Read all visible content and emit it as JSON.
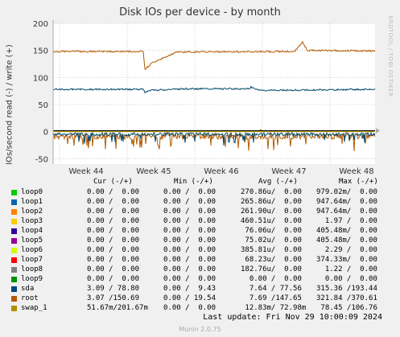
{
  "chart_data": {
    "type": "line",
    "title": "Disk IOs per device - by month",
    "ylabel": "IOs/second read (-) / write (+)",
    "ylim": [
      -60,
      200
    ],
    "yticks": [
      -50,
      0,
      50,
      100,
      150,
      200
    ],
    "x_ticks": [
      "Week 44",
      "Week 45",
      "Week 46",
      "Week 47",
      "Week 48"
    ],
    "grid": true,
    "series": [
      {
        "name": "root",
        "color": "#b35a00",
        "write_profile": [
          [
            0,
            148
          ],
          [
            0.28,
            148
          ],
          [
            0.285,
            115
          ],
          [
            0.31,
            128
          ],
          [
            0.36,
            140
          ],
          [
            0.38,
            147
          ],
          [
            0.75,
            148
          ],
          [
            0.775,
            165
          ],
          [
            0.79,
            150
          ],
          [
            1,
            149
          ]
        ],
        "read_profile": [
          [
            0,
            -8
          ],
          [
            1,
            -8
          ]
        ]
      },
      {
        "name": "sda",
        "color": "#00486b",
        "write_profile": [
          [
            0,
            78
          ],
          [
            0.28,
            78
          ],
          [
            0.285,
            72
          ],
          [
            0.3,
            76
          ],
          [
            0.4,
            79
          ],
          [
            0.61,
            79
          ],
          [
            0.615,
            82
          ],
          [
            0.64,
            76
          ],
          [
            1,
            78
          ]
        ],
        "read_profile": [
          [
            0,
            -3
          ],
          [
            1,
            -3
          ]
        ]
      },
      {
        "name": "swap_1",
        "color": "#b39500",
        "write_profile": [
          [
            0,
            0
          ],
          [
            0.64,
            0
          ],
          [
            0.645,
            4
          ],
          [
            0.65,
            0
          ],
          [
            1,
            0
          ]
        ],
        "read_profile": [
          [
            0,
            0
          ],
          [
            1,
            0
          ]
        ]
      }
    ]
  },
  "side_label": "IOs/second read (-) / write (+)",
  "watermark": "RRDTOOL / TOBI OETIKER",
  "legend": {
    "headers": {
      "cur": "Cur (-/+)",
      "min": "Min (-/+)",
      "avg": "Avg (-/+)",
      "max": "Max (-/+)"
    },
    "rows": [
      {
        "name": "loop0",
        "color": "#00cc00",
        "cur": "0.00 /  0.00",
        "min": "0.00 /  0.00",
        "avg": "270.86u/  0.00",
        "max": "979.02m/  0.00"
      },
      {
        "name": "loop1",
        "color": "#0066b3",
        "cur": "0.00 /  0.00",
        "min": "0.00 /  0.00",
        "avg": "265.86u/  0.00",
        "max": "947.64m/  0.00"
      },
      {
        "name": "loop2",
        "color": "#ff8000",
        "cur": "0.00 /  0.00",
        "min": "0.00 /  0.00",
        "avg": "261.90u/  0.00",
        "max": "947.64m/  0.00"
      },
      {
        "name": "loop3",
        "color": "#ffcc00",
        "cur": "0.00 /  0.00",
        "min": "0.00 /  0.00",
        "avg": "460.51u/  0.00",
        "max": "  1.97 /  0.00"
      },
      {
        "name": "loop4",
        "color": "#330099",
        "cur": "0.00 /  0.00",
        "min": "0.00 /  0.00",
        "avg": " 76.06u/  0.00",
        "max": "405.48m/  0.00"
      },
      {
        "name": "loop5",
        "color": "#990099",
        "cur": "0.00 /  0.00",
        "min": "0.00 /  0.00",
        "avg": " 75.02u/  0.00",
        "max": "405.48m/  0.00"
      },
      {
        "name": "loop6",
        "color": "#ccff00",
        "cur": "0.00 /  0.00",
        "min": "0.00 /  0.00",
        "avg": "385.81u/  0.00",
        "max": "  2.29 /  0.00"
      },
      {
        "name": "loop7",
        "color": "#ff0000",
        "cur": "0.00 /  0.00",
        "min": "0.00 /  0.00",
        "avg": " 68.23u/  0.00",
        "max": "374.33m/  0.00"
      },
      {
        "name": "loop8",
        "color": "#808080",
        "cur": "0.00 /  0.00",
        "min": "0.00 /  0.00",
        "avg": "182.76u/  0.00",
        "max": "  1.22 /  0.00"
      },
      {
        "name": "loop9",
        "color": "#008f00",
        "cur": "0.00 /  0.00",
        "min": "0.00 /  0.00",
        "avg": "  0.00 /  0.00",
        "max": "  0.00 /  0.00"
      },
      {
        "name": "sda",
        "color": "#00487d",
        "cur": "3.09 / 78.80",
        "min": "0.00 /  9.43",
        "avg": "  7.64 / 77.56",
        "max": "315.36 /193.44"
      },
      {
        "name": "root",
        "color": "#b35a00",
        "cur": "3.07 /150.69",
        "min": "0.00 / 19.54",
        "avg": "  7.69 /147.65",
        "max": "321.84 /370.61"
      },
      {
        "name": "swap_1",
        "color": "#b38f00",
        "cur": "51.67m/201.67m",
        "min": "0.00 /  0.00",
        "avg": " 12.83m/ 72.98m",
        "max": " 78.45 /106.76"
      }
    ]
  },
  "last_update": "Last update: Fri Nov 29 10:00:09 2024",
  "munin_version": "Munin 2.0.75"
}
